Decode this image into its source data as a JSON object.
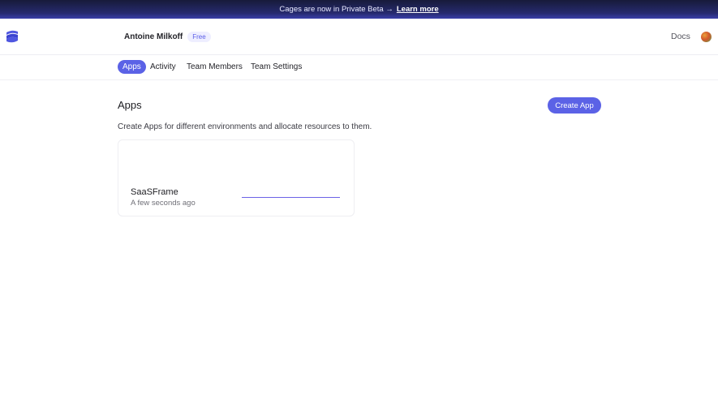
{
  "banner": {
    "text": "Cages are now in Private Beta →",
    "link": "Learn more"
  },
  "header": {
    "team_name": "Antoine Milkoff",
    "plan_badge": "Free",
    "docs_label": "Docs"
  },
  "tabs": [
    {
      "label": "Apps",
      "active": true
    },
    {
      "label": "Activity",
      "active": false
    },
    {
      "label": "Team Members",
      "active": false
    },
    {
      "label": "Team Settings",
      "active": false
    }
  ],
  "main": {
    "title": "Apps",
    "create_button": "Create App",
    "description": "Create Apps for different environments and allocate resources to them."
  },
  "apps": [
    {
      "name": "SaaSFrame",
      "updated": "A few seconds ago"
    }
  ],
  "colors": {
    "accent": "#5b62e6",
    "banner_bg": "#1c1f4d"
  }
}
